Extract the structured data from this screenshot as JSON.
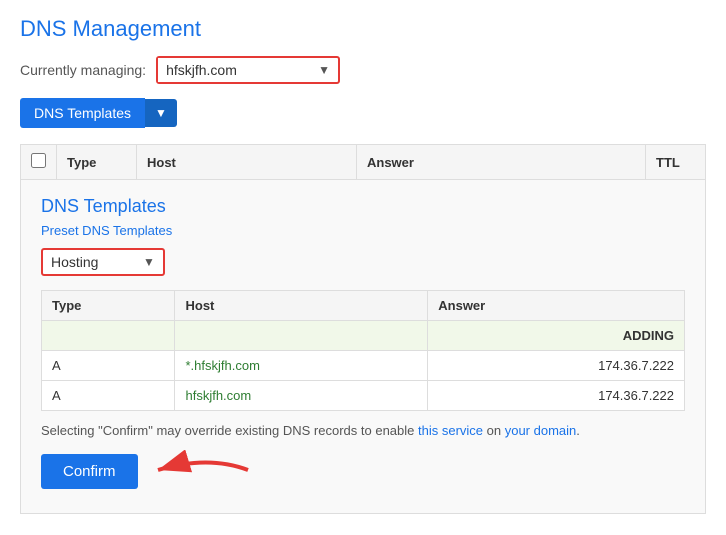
{
  "page": {
    "title": "DNS Management",
    "currently_managing_label": "Currently managing:",
    "domain_value": "hfskjfh.com",
    "domain_options": [
      "hfskjfh.com"
    ],
    "dns_templates_button": "DNS Templates",
    "table": {
      "columns": [
        "",
        "Type",
        "Host",
        "Answer",
        "TTL"
      ]
    },
    "dns_panel": {
      "title": "DNS Templates",
      "subtitle": "Preset DNS Templates",
      "hosting_select_value": "Hosting",
      "hosting_select_options": [
        "Hosting"
      ],
      "inner_table": {
        "columns": [
          "Type",
          "Host",
          "Answer"
        ],
        "adding_label": "ADDING",
        "rows": [
          {
            "type": "A",
            "host": "*.hfskjfh.com",
            "answer": "174.36.7.222"
          },
          {
            "type": "A",
            "host": "hfskjfh.com",
            "answer": "174.36.7.222"
          }
        ]
      },
      "warning_text": "Selecting \"Confirm\" may override existing DNS records to enable this service on your domain.",
      "confirm_button": "Confirm"
    }
  }
}
